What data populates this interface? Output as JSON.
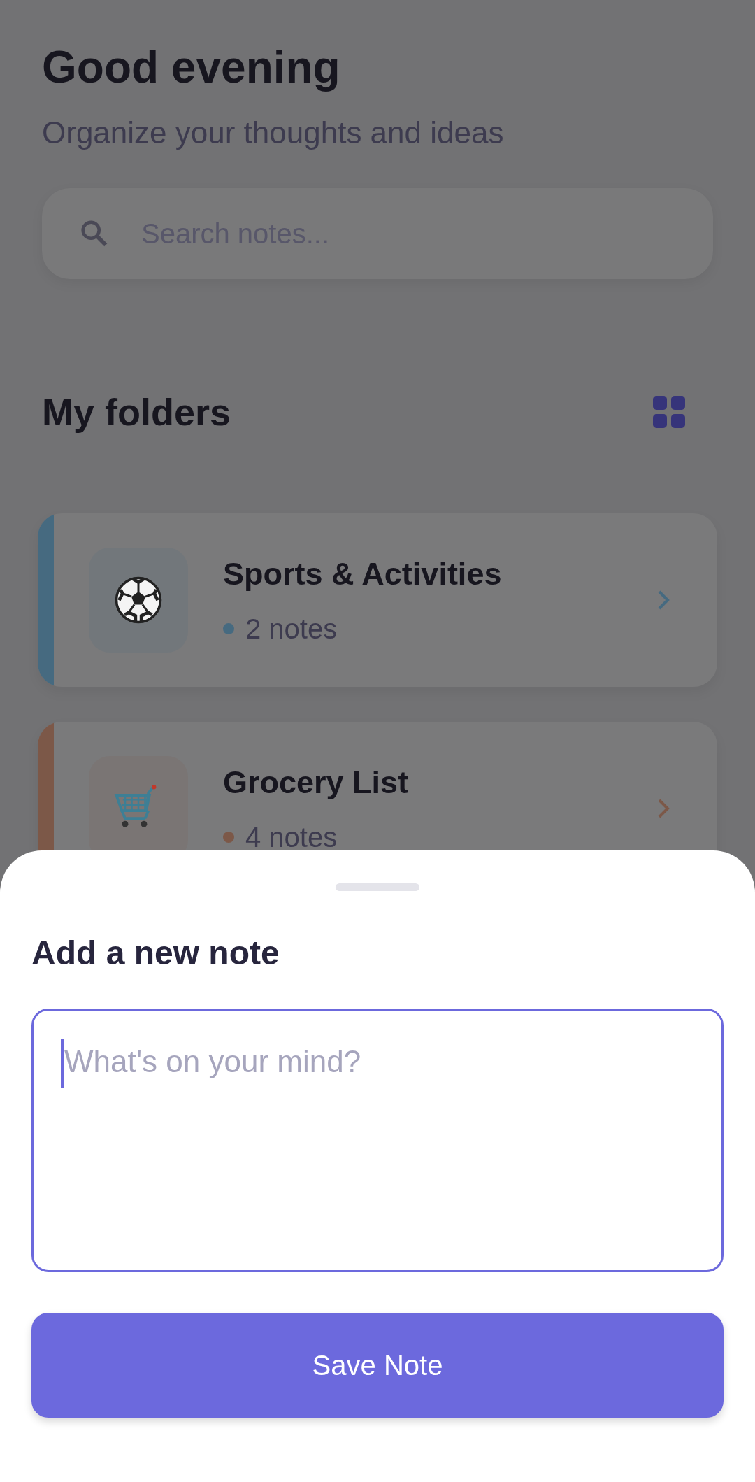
{
  "header": {
    "greeting": "Good evening",
    "subtitle": "Organize your thoughts and ideas"
  },
  "search": {
    "placeholder": "Search notes..."
  },
  "folders_section": {
    "title": "My folders"
  },
  "folders": [
    {
      "name": "Sports & Activities",
      "count": "2 notes",
      "kind": "ball",
      "color": "#466a80"
    },
    {
      "name": "Grocery List",
      "count": "4 notes",
      "kind": "cart",
      "color": "#7c5848"
    }
  ],
  "sheet": {
    "title": "Add a new note",
    "input": {
      "placeholder": "What's on your mind?",
      "focused": true
    },
    "button": "Save Note"
  }
}
